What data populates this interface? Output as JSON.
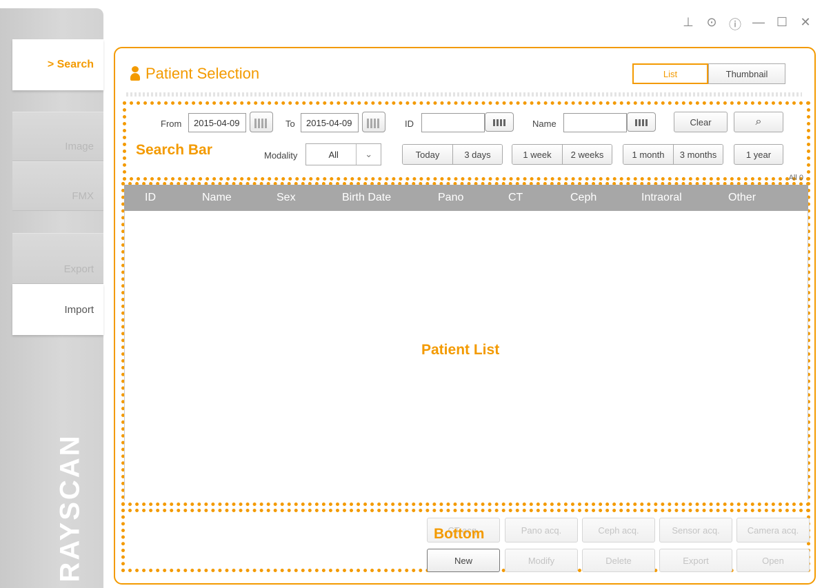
{
  "window_controls": [
    "pin-icon",
    "settings-icon",
    "help-icon",
    "minimize-icon",
    "maximize-icon",
    "close-icon"
  ],
  "sidebar": {
    "items": [
      {
        "label": "> Search",
        "state": "active"
      },
      {
        "label": "Image",
        "state": "disabled"
      },
      {
        "label": "FMX",
        "state": "disabled"
      },
      {
        "label": "Export",
        "state": "disabled"
      },
      {
        "label": "Import",
        "state": "normal"
      }
    ],
    "brand": "RAYSCAN"
  },
  "header": {
    "title": "Patient Selection",
    "view_list": "List",
    "view_thumbnail": "Thumbnail"
  },
  "annotations": {
    "search_bar": "Search Bar",
    "patient_list": "Patient List",
    "bottom": "Bottom"
  },
  "search": {
    "from_label": "From",
    "from_value": "2015-04-09",
    "to_label": "To",
    "to_value": "2015-04-09",
    "id_label": "ID",
    "id_value": "",
    "name_label": "Name",
    "name_value": "",
    "clear": "Clear",
    "modality_label": "Modality",
    "modality_value": "All",
    "ranges": [
      "Today",
      "3 days",
      "1 week",
      "2 weeks",
      "1 month",
      "3 months",
      "1 year"
    ],
    "count": "All 0"
  },
  "table": {
    "columns": [
      "ID",
      "Name",
      "Sex",
      "Birth Date",
      "Pano",
      "CT",
      "Ceph",
      "Intraoral",
      "Other"
    ],
    "rows": []
  },
  "bottom": {
    "acq_buttons": [
      "CT acq.",
      "Pano acq.",
      "Ceph acq.",
      "Sensor acq.",
      "Camera acq."
    ],
    "actions": [
      "New",
      "Modify",
      "Delete",
      "Export",
      "Open"
    ]
  },
  "colors": {
    "accent": "#f39a00",
    "header_bg": "#a7a7a7"
  }
}
